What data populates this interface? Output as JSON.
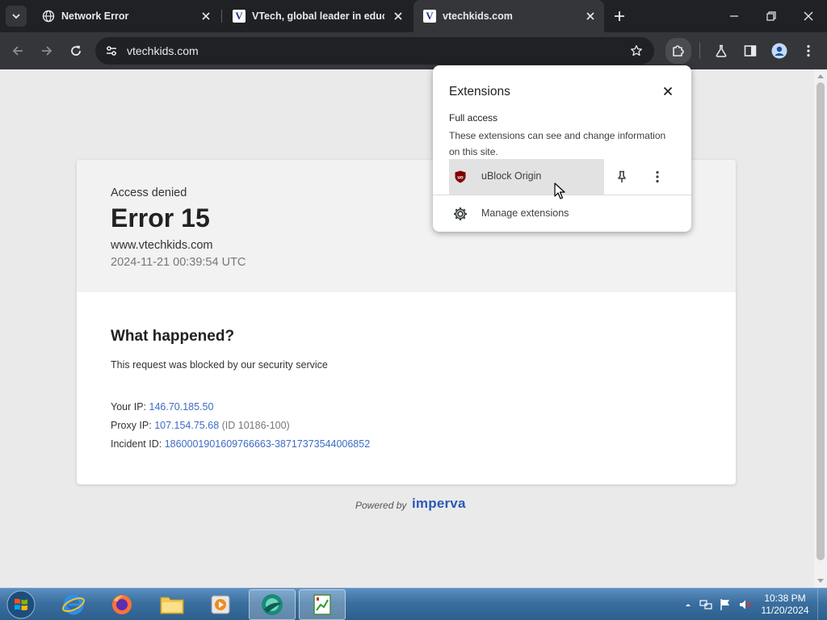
{
  "tabs": [
    {
      "title": "Network Error",
      "favicon": "globe-icon"
    },
    {
      "title": "VTech, global leader in educati",
      "favicon": "vtech-icon"
    },
    {
      "title": "vtechkids.com",
      "favicon": "vtech-icon",
      "active": true
    }
  ],
  "omnibox": {
    "url": "vtechkids.com"
  },
  "page": {
    "access_denied": "Access denied",
    "error_title": "Error 15",
    "site": "www.vtechkids.com",
    "timestamp": "2024-11-21 00:39:54 UTC",
    "what_happened": "What happened?",
    "blocked_msg": "This request was blocked by our security service",
    "your_ip_label": "Your IP:",
    "your_ip": "146.70.185.50",
    "proxy_ip_label": "Proxy IP:",
    "proxy_ip": "107.154.75.68",
    "proxy_id": "(ID 10186-100)",
    "incident_label": "Incident ID:",
    "incident_id": "1860001901609766663-38717373544006852",
    "powered_by": "Powered by",
    "brand": "imperva"
  },
  "extensions_popup": {
    "title": "Extensions",
    "section": "Full access",
    "description": "These extensions can see and change information on this site.",
    "extension_name": "uBlock Origin",
    "manage": "Manage extensions"
  },
  "taskbar": {
    "time": "10:38 PM",
    "date": "11/20/2024"
  },
  "colors": {
    "browser_dark": "#202124",
    "toolbar": "#35363a",
    "link": "#3d6bc4",
    "imperva_blue": "#2a5ab8"
  }
}
